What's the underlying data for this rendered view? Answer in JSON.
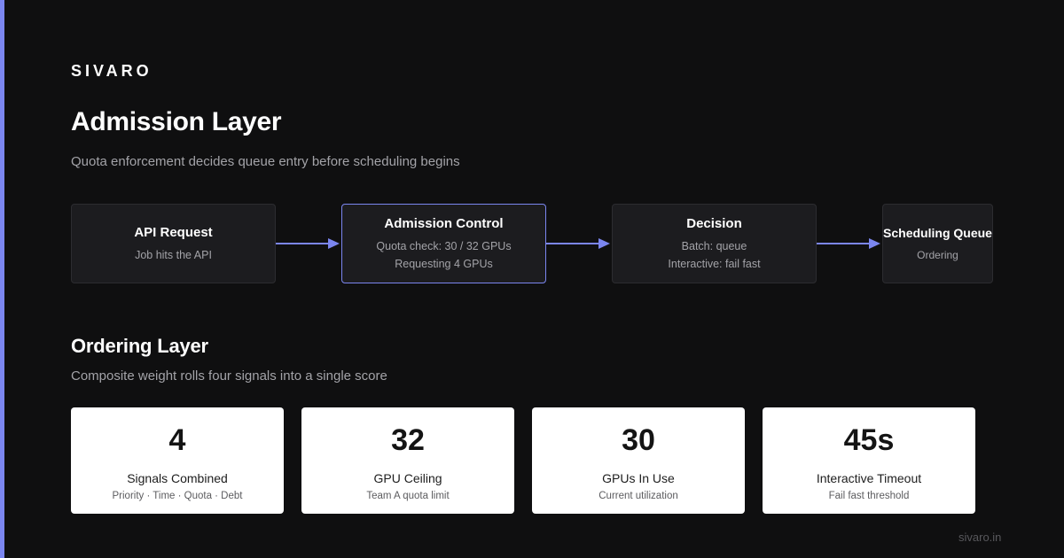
{
  "brand": "SIVARO",
  "admission": {
    "title": "Admission Layer",
    "subtitle": "Quota enforcement decides queue entry before scheduling begins",
    "steps": [
      {
        "title": "API Request",
        "lines": [
          "Job hits the API"
        ]
      },
      {
        "title": "Admission Control",
        "lines": [
          "Quota check: 30 / 32 GPUs",
          "Requesting 4 GPUs"
        ]
      },
      {
        "title": "Decision",
        "lines": [
          "Batch: queue",
          "Interactive: fail fast"
        ]
      },
      {
        "title": "Scheduling Queue",
        "lines": [
          "Ordering"
        ]
      }
    ]
  },
  "ordering": {
    "title": "Ordering Layer",
    "subtitle": "Composite weight rolls four signals into a single score",
    "stats": [
      {
        "value": "4",
        "label": "Signals Combined",
        "note": "Priority · Time · Quota · Debt"
      },
      {
        "value": "32",
        "label": "GPU Ceiling",
        "note": "Team A quota limit"
      },
      {
        "value": "30",
        "label": "GPUs In Use",
        "note": "Current utilization"
      },
      {
        "value": "45s",
        "label": "Interactive Timeout",
        "note": "Fail fast threshold"
      }
    ]
  },
  "footer": "sivaro.in",
  "colors": {
    "accent": "#7b86f0",
    "background": "#0f0f10",
    "box": "#1c1c1f",
    "card": "#ffffff"
  }
}
